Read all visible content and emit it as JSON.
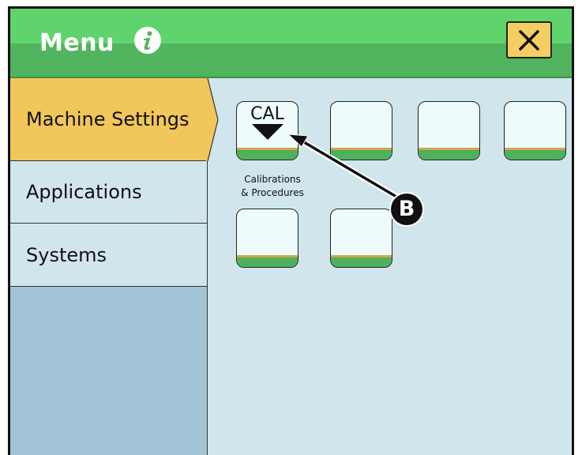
{
  "header": {
    "title": "Menu",
    "info_icon": "info-icon",
    "close_icon": "close-icon"
  },
  "sidebar": {
    "items": [
      {
        "label": "Machine Settings",
        "active": true
      },
      {
        "label": "Applications",
        "active": false
      },
      {
        "label": "Systems",
        "active": false
      }
    ]
  },
  "tiles": [
    {
      "label": "CAL",
      "caption_line1": "Calibrations",
      "caption_line2": "& Procedures"
    },
    {
      "label": ""
    },
    {
      "label": ""
    },
    {
      "label": ""
    },
    {
      "label": ""
    },
    {
      "label": ""
    }
  ],
  "callout": {
    "label": "B"
  },
  "colors": {
    "header_green": "#60d46c",
    "active_yellow": "#f1c65a",
    "panel_blue": "#d0e6ec",
    "sidebar_fill": "#a2c3d6",
    "close_button": "#f3cf62"
  }
}
